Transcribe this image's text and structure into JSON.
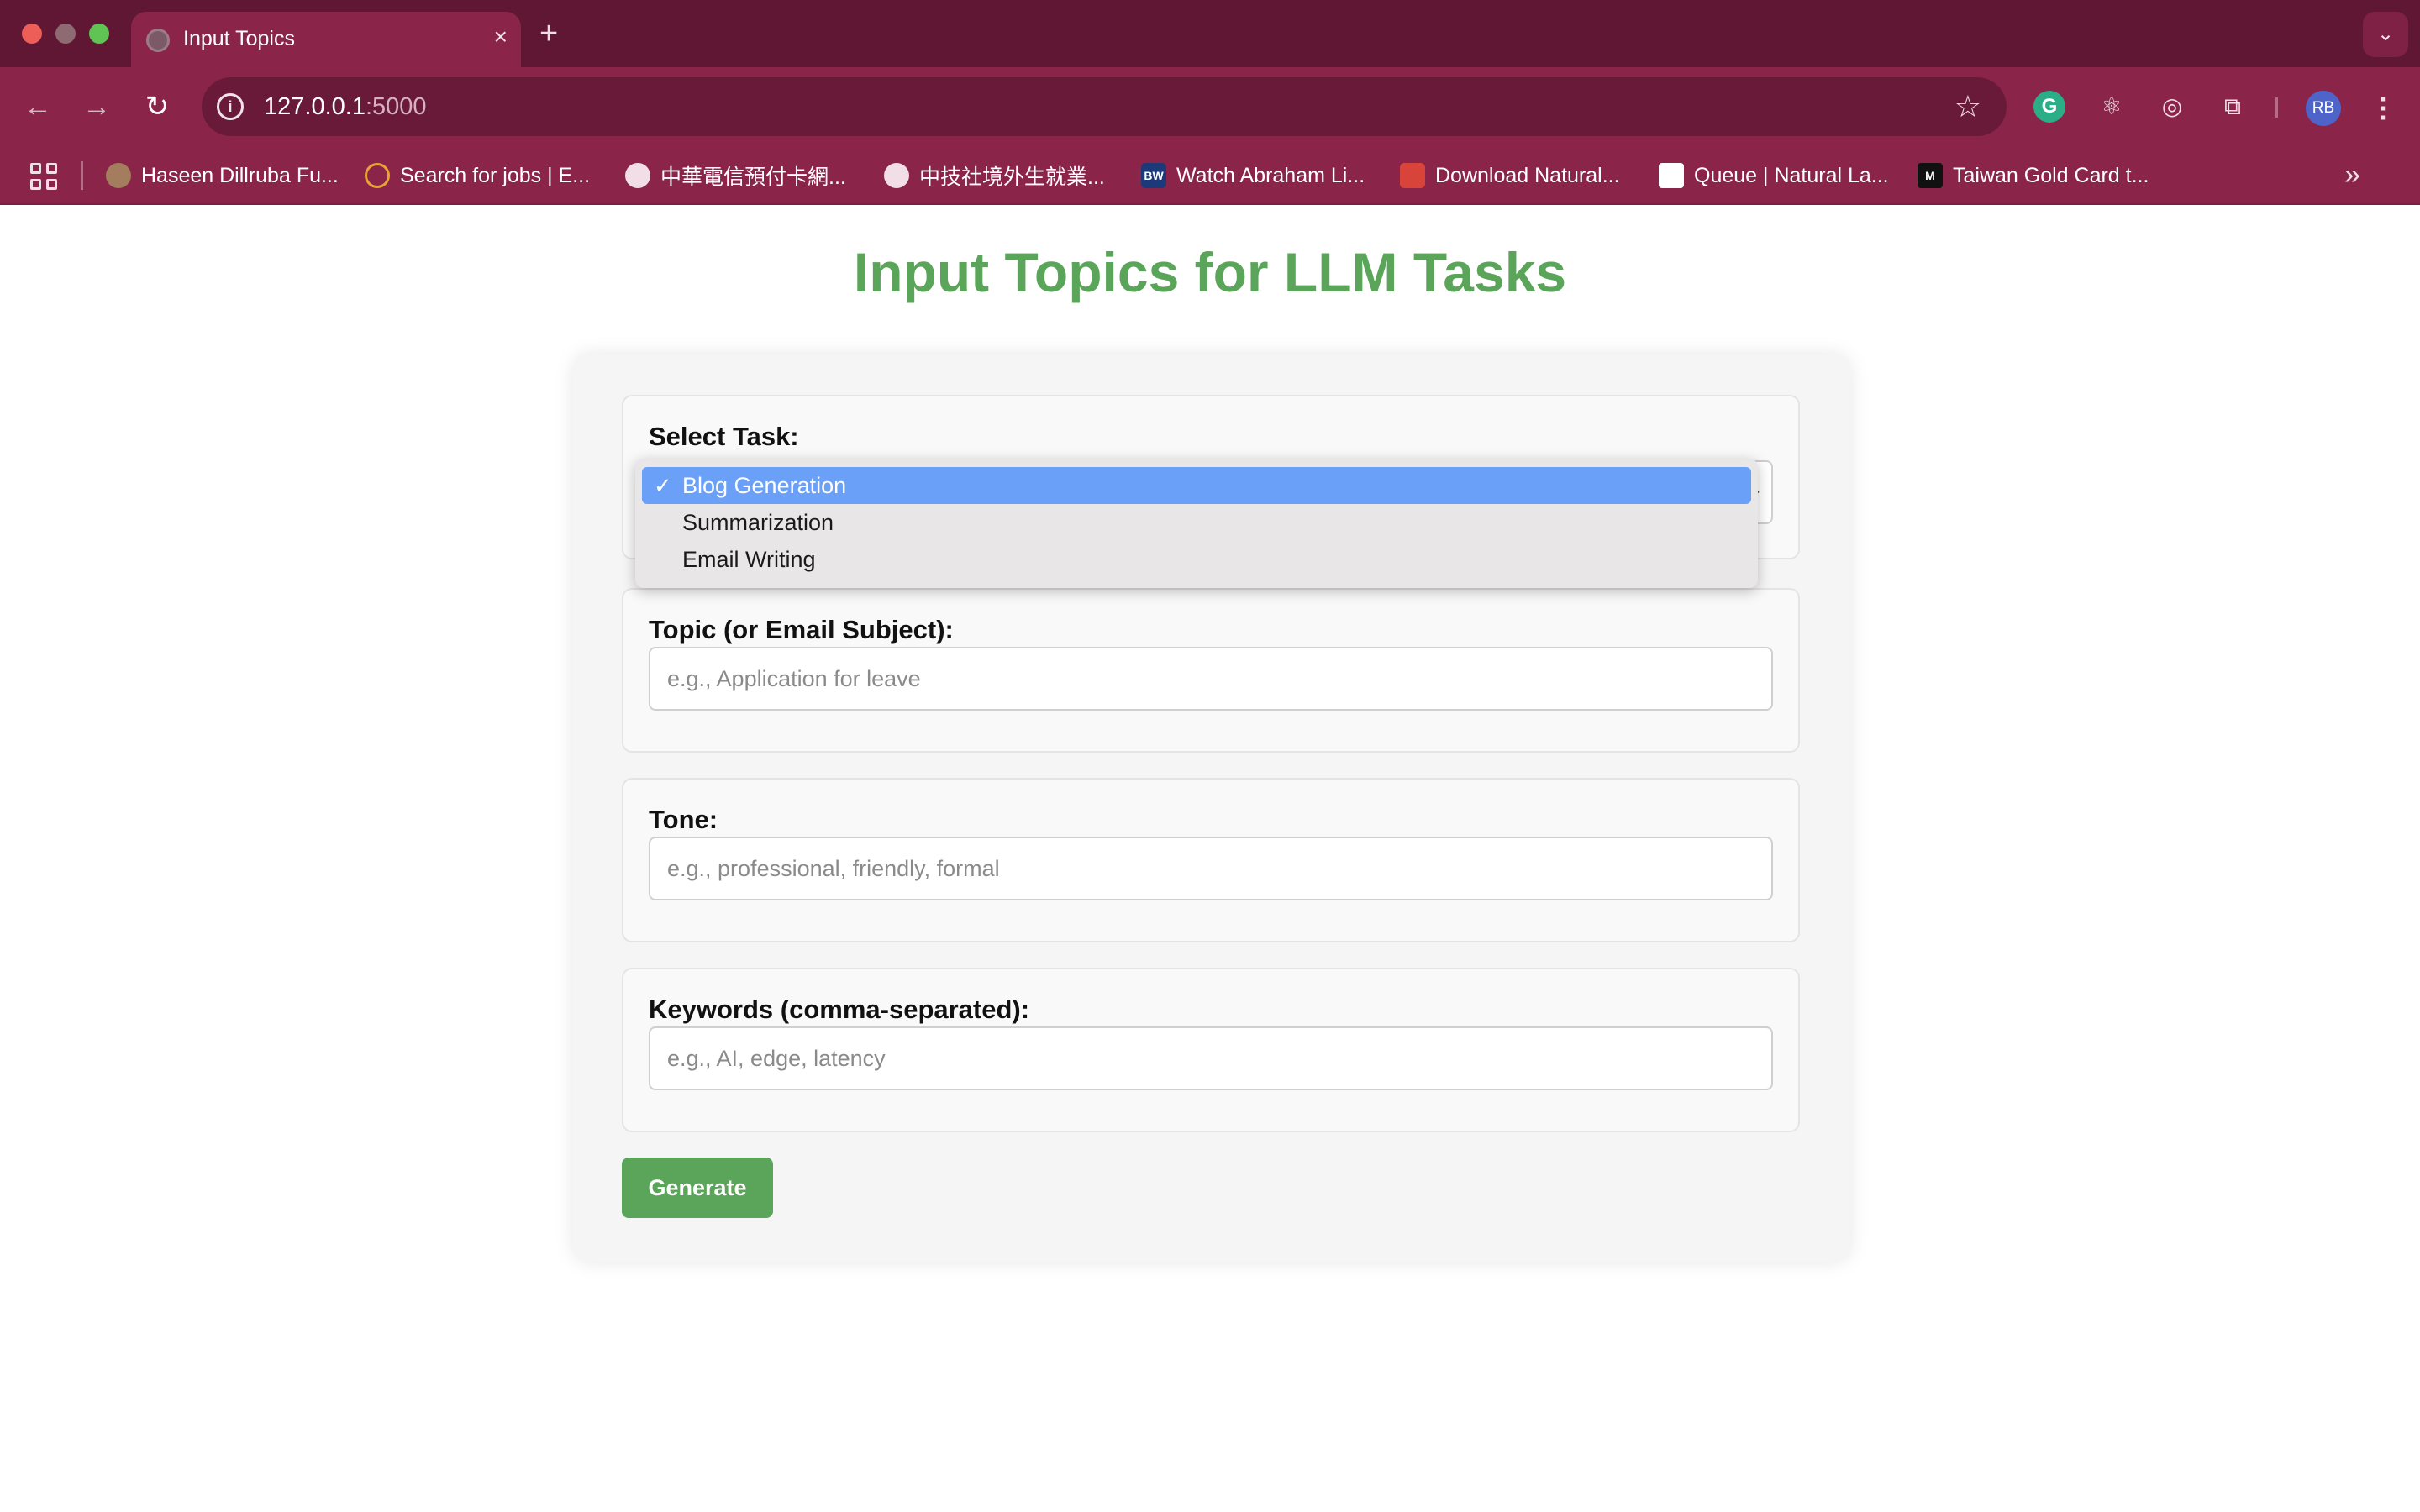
{
  "browser": {
    "tab_title": "Input Topics",
    "tab_close": "×",
    "new_tab": "+",
    "url_host": "127.0.0.1",
    "url_port": ":5000",
    "avatar_initials": "RB",
    "extensions": [
      "grammarly-icon",
      "react-devtools-icon",
      "target-icon",
      "puzzle-icon"
    ],
    "bookmarks": [
      {
        "label": "Haseen Dillruba Fu...",
        "icon": "tent-icon"
      },
      {
        "label": "Search for jobs | E...",
        "icon": "people-icon"
      },
      {
        "label": "中華電信預付卡網...",
        "icon": "globe-icon"
      },
      {
        "label": "中技社境外生就業...",
        "icon": "globe-icon"
      },
      {
        "label": "Watch Abraham Li...",
        "icon": "bw-icon"
      },
      {
        "label": "Download Natural...",
        "icon": "download-icon"
      },
      {
        "label": "Queue | Natural La...",
        "icon": "queue-icon"
      },
      {
        "label": "Taiwan Gold Card t...",
        "icon": "medium-icon"
      }
    ]
  },
  "page": {
    "title": "Input Topics for LLM Tasks",
    "task": {
      "label": "Select Task:",
      "selected": "Blog Generation",
      "options": [
        "Blog Generation",
        "Summarization",
        "Email Writing"
      ]
    },
    "topic": {
      "label": "Topic (or Email Subject):",
      "placeholder": "e.g., Application for leave"
    },
    "tone": {
      "label": "Tone:",
      "placeholder": "e.g., professional, friendly, formal"
    },
    "keywords": {
      "label": "Keywords (comma-separated):",
      "placeholder": "e.g., AI, edge, latency"
    },
    "generate_label": "Generate"
  },
  "colors": {
    "accent_green": "#5aa559",
    "chrome_maroon": "#8a2549",
    "selected_option": "#6aa0f7"
  }
}
